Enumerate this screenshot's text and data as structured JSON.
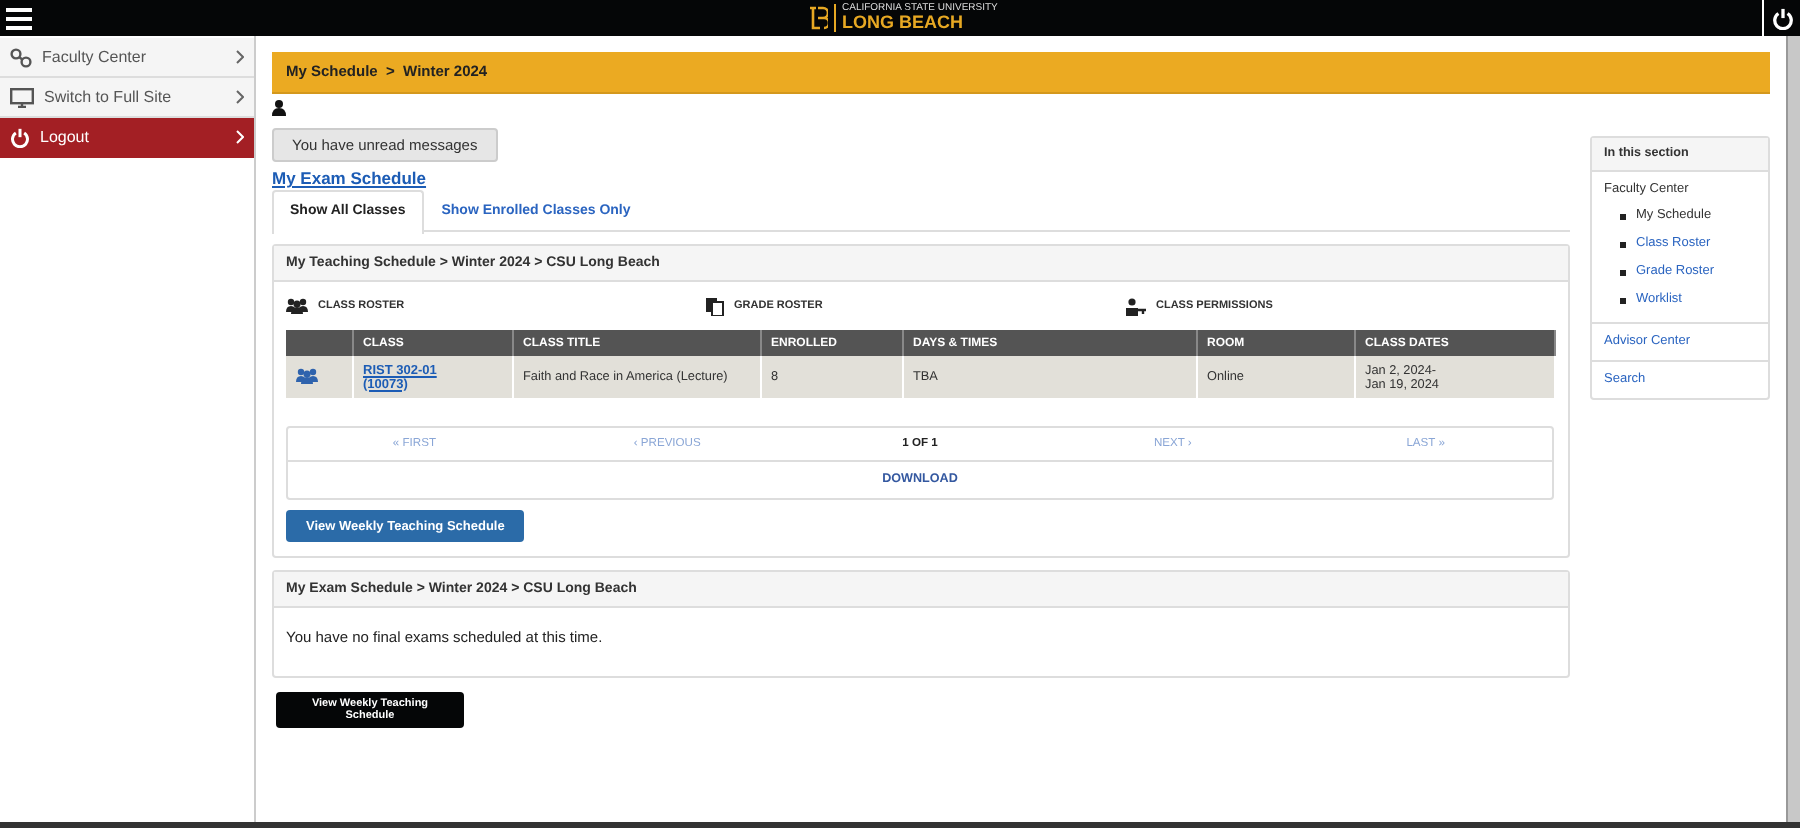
{
  "header": {
    "logo_small": "CALIFORNIA STATE UNIVERSITY",
    "logo_large": "LONG BEACH"
  },
  "sidebar": {
    "items": [
      {
        "label": "Faculty Center",
        "kind": "link"
      },
      {
        "label": "Switch to Full Site",
        "kind": "desktop"
      },
      {
        "label": "Logout",
        "kind": "logout"
      }
    ]
  },
  "breadcrumb": "My Schedule  >  Winter 2024",
  "messages_button": "You have unread messages",
  "exam_link": "My Exam Schedule",
  "tabs": [
    {
      "label": "Show All Classes",
      "selected": true
    },
    {
      "label": "Show Enrolled Classes Only",
      "selected": false
    }
  ],
  "teaching": {
    "title": "My Teaching Schedule > Winter 2024 > CSU Long Beach",
    "actions": [
      {
        "label": "CLASS ROSTER",
        "kind": "roster"
      },
      {
        "label": "GRADE ROSTER",
        "kind": "grade"
      },
      {
        "label": "CLASS PERMISSIONS",
        "kind": "permissions"
      }
    ],
    "table": {
      "columns": [
        "CLASS",
        "CLASS TITLE",
        "ENROLLED",
        "DAYS & TIMES",
        "ROOM",
        "CLASS DATES"
      ],
      "rows": [
        {
          "class": [
            "RIST 302-01",
            "(10073)"
          ],
          "title": "Faith and Race in America (Lecture)",
          "enrolled": "8",
          "days_times": "TBA",
          "room": "Online",
          "dates": [
            "Jan 2, 2024-",
            "Jan 19, 2024"
          ]
        }
      ]
    },
    "pager": {
      "first": "« FIRST",
      "previous": "‹ PREVIOUS",
      "page": "1 OF 1",
      "next": "NEXT ›",
      "last": "LAST »",
      "download": "DOWNLOAD"
    },
    "button": "View Weekly Teaching Schedule"
  },
  "exam": {
    "title": "My Exam Schedule > Winter 2024 > CSU Long Beach",
    "message": "You have no final exams scheduled at this time."
  },
  "bottom_button": "View Weekly Teaching Schedule",
  "aside": {
    "title": "In this section",
    "heading": "Faculty Center",
    "items": [
      {
        "label": "My Schedule",
        "selected": true
      },
      {
        "label": "Class Roster",
        "selected": false
      },
      {
        "label": "Grade Roster",
        "selected": false
      },
      {
        "label": "Worklist",
        "selected": false
      }
    ],
    "links": [
      "Advisor Center",
      "Search"
    ]
  }
}
